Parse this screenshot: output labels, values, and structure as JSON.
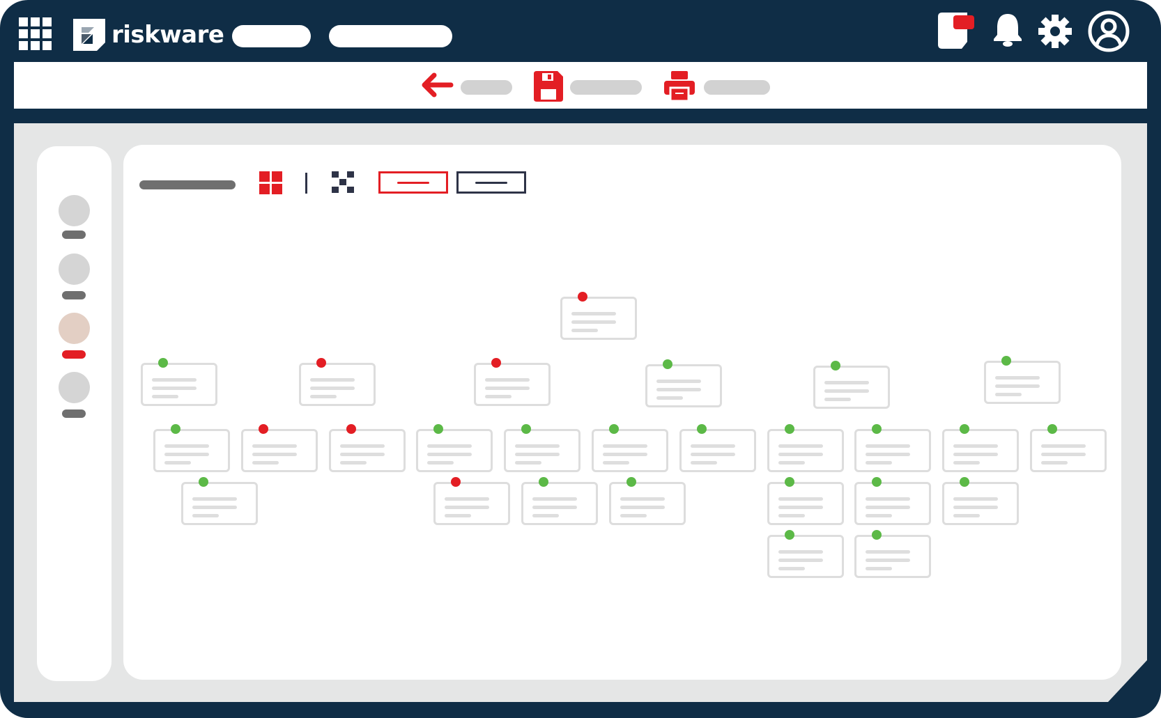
{
  "app": {
    "brand_name": "riskware"
  },
  "icons": {
    "apps": "apps-grid-icon",
    "logo": "riskware-logo-icon",
    "notes": "notes-icon",
    "notifications": "bell-icon",
    "settings": "gear-icon",
    "account": "user-avatar-icon",
    "back": "back-arrow-icon",
    "save": "save-icon",
    "print": "print-icon",
    "grid_view": "grid-view-icon",
    "pattern_view": "checker-view-icon"
  },
  "colors": {
    "frame": "#0f2d46",
    "accent_red": "#e31e24",
    "status_green": "#5cb947",
    "status_red": "#e31e24",
    "sidebar_active": "#e3cfc4"
  },
  "sidebar": {
    "items": [
      {
        "id": "item-1",
        "active": false
      },
      {
        "id": "item-2",
        "active": false
      },
      {
        "id": "item-3",
        "active": true
      },
      {
        "id": "item-4",
        "active": false
      }
    ]
  },
  "org_chart": {
    "nodes": [
      {
        "id": "root",
        "status": "red"
      },
      {
        "id": "b1",
        "status": "green",
        "parent": "root"
      },
      {
        "id": "b2",
        "status": "red",
        "parent": "root"
      },
      {
        "id": "b3",
        "status": "red",
        "parent": "root"
      },
      {
        "id": "b4",
        "status": "green",
        "parent": "root"
      },
      {
        "id": "b5",
        "status": "green",
        "parent": "root"
      },
      {
        "id": "b6",
        "status": "green",
        "parent": "root"
      },
      {
        "id": "c1",
        "status": "green"
      },
      {
        "id": "c2",
        "status": "red"
      },
      {
        "id": "c3",
        "status": "red"
      },
      {
        "id": "c4",
        "status": "green"
      },
      {
        "id": "c5",
        "status": "green"
      },
      {
        "id": "c6",
        "status": "green"
      },
      {
        "id": "c7",
        "status": "green"
      },
      {
        "id": "c8",
        "status": "green"
      },
      {
        "id": "c9",
        "status": "green"
      },
      {
        "id": "c10",
        "status": "green"
      },
      {
        "id": "c11",
        "status": "green"
      },
      {
        "id": "d1",
        "status": "green"
      },
      {
        "id": "d2",
        "status": "red"
      },
      {
        "id": "d3",
        "status": "green"
      },
      {
        "id": "d4",
        "status": "green"
      },
      {
        "id": "d5",
        "status": "green"
      },
      {
        "id": "d6",
        "status": "green"
      },
      {
        "id": "d7",
        "status": "green"
      },
      {
        "id": "e1",
        "status": "green"
      },
      {
        "id": "e2",
        "status": "green"
      }
    ]
  }
}
